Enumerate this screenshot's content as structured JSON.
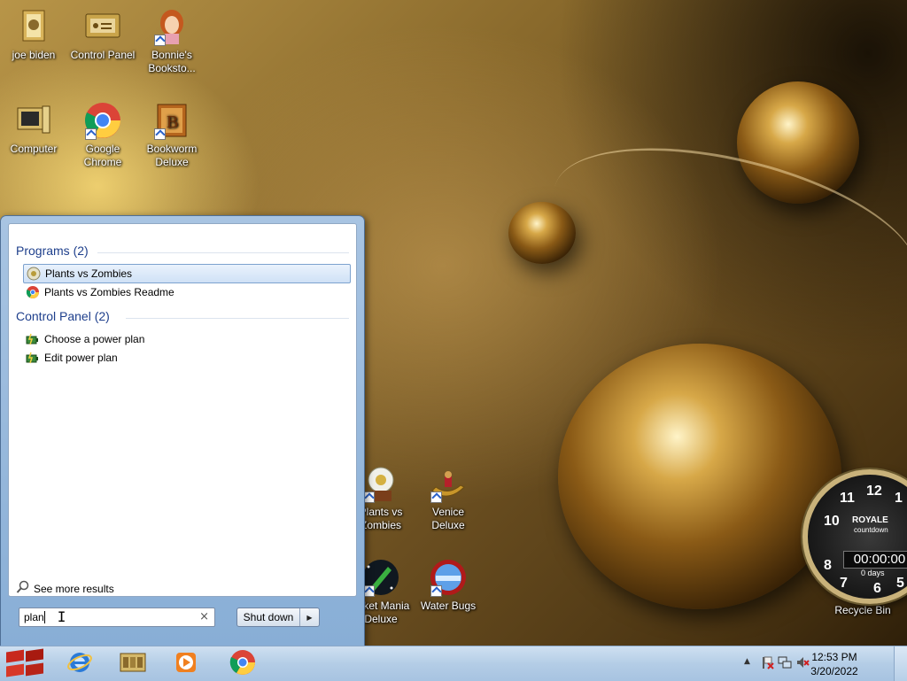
{
  "desktop": {
    "icons": [
      {
        "name": "joe-biden",
        "label": "joe biden"
      },
      {
        "name": "control-panel",
        "label": "Control Panel"
      },
      {
        "name": "bonnies-bookstore",
        "label": "Bonnie's Booksto..."
      },
      {
        "name": "computer",
        "label": "Computer"
      },
      {
        "name": "google-chrome",
        "label": "Google Chrome"
      },
      {
        "name": "bookworm-deluxe",
        "label": "Bookworm Deluxe"
      },
      {
        "name": "plants-vs-zombies",
        "label": "Plants vs Zombies"
      },
      {
        "name": "venice-deluxe",
        "label": "Venice Deluxe"
      },
      {
        "name": "rocket-mania-deluxe",
        "label": "ocket Mania Deluxe"
      },
      {
        "name": "water-bugs",
        "label": "Water Bugs"
      },
      {
        "name": "recycle-bin",
        "label": "Recycle Bin"
      }
    ]
  },
  "start_menu": {
    "groups": [
      {
        "header": "Programs (2)",
        "items": [
          {
            "label": "Plants vs Zombies",
            "icon": "sunflower-icon",
            "selected": true
          },
          {
            "label": "Plants vs Zombies Readme",
            "icon": "chrome-icon",
            "selected": false
          }
        ]
      },
      {
        "header": "Control Panel (2)",
        "items": [
          {
            "label": "Choose a power plan",
            "icon": "power-plan-icon",
            "selected": false
          },
          {
            "label": "Edit power plan",
            "icon": "power-plan-icon",
            "selected": false
          }
        ]
      }
    ],
    "see_more": "See more results",
    "search_value": "plan",
    "clear_glyph": "×",
    "shutdown_label": "Shut down"
  },
  "gadget": {
    "brand": "ROYALE",
    "sub": "countdown",
    "time": "00:00:00",
    "days": "0 days",
    "numbers": [
      "12",
      "1",
      "11",
      "10",
      "8",
      "7",
      "6",
      "5"
    ]
  },
  "taskbar": {
    "clock_time": "12:53 PM",
    "clock_date": "3/20/2022"
  },
  "colors": {
    "group_header": "#1e3f8c",
    "taskbar": "#b4cde6"
  }
}
